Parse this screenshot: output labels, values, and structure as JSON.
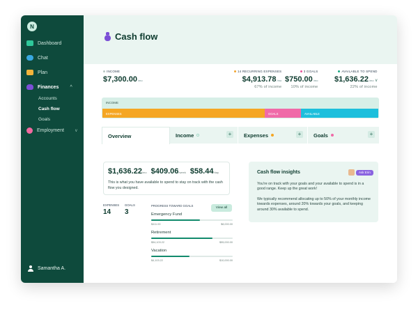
{
  "sidebar": {
    "logo": "N",
    "items": [
      {
        "label": "Dashboard",
        "color": "#2ec89a"
      },
      {
        "label": "Chat",
        "color": "#38a8e0"
      },
      {
        "label": "Plan",
        "color": "#f2b43a"
      },
      {
        "label": "Finances",
        "color": "#7b4fd6"
      },
      {
        "label": "Employment",
        "color": "#f26aa0"
      }
    ],
    "finances_sub": [
      "Accounts",
      "Cash flow",
      "Goals"
    ],
    "user": "Samantha A."
  },
  "header": {
    "title": "Cash flow"
  },
  "summary": {
    "income": {
      "label": "INCOME",
      "amount": "$7,300.00",
      "unit": "/mo"
    },
    "expenses": {
      "label": "14 RECURRING EXPENSES",
      "amount": "$4,913.78",
      "unit": "/mo",
      "pct": "67% of income",
      "color": "#f2a532"
    },
    "goals": {
      "label": "3 GOALS",
      "amount": "$750.00",
      "unit": "/mo",
      "pct": "10% of income",
      "color": "#e8559a"
    },
    "available": {
      "label": "AVAILABLE TO SPEND",
      "amount": "$1,636.22",
      "unit": "/mo",
      "pct": "22% of income",
      "color": "#1aa883"
    }
  },
  "breakdown": {
    "label": "INCOME",
    "segments": [
      {
        "label": "EXPENSES",
        "fraction": 0.588,
        "color": "#f5a623"
      },
      {
        "label": "GOALS",
        "fraction": 0.131,
        "color": "#f06aa8"
      },
      {
        "label": "AVAILABLE",
        "fraction": 0.281,
        "color": "#1cbfdc"
      }
    ]
  },
  "tabs": [
    {
      "label": "Overview",
      "active": true
    },
    {
      "label": "Income",
      "dot": "#9fd6c4"
    },
    {
      "label": "Expenses",
      "dot": "#f5a623"
    },
    {
      "label": "Goals",
      "dot": "#f06aa8"
    }
  ],
  "overview": {
    "daily": "$1,636.22",
    "daily_unit": "/mo",
    "weekly": "$409.06",
    "weekly_unit": "/week",
    "per_day": "$58.44",
    "per_day_unit": "/day",
    "desc": "This is what you have available to spend to stay on track with the cash flow you designed.",
    "expenses_label": "EXPENSES",
    "expenses_count": "14",
    "goals_label": "GOALS",
    "goals_count": "3",
    "progress_title": "PROGRESS TOWARD GOALS",
    "view_all": "View all",
    "goals": [
      {
        "name": "Emergency Fund",
        "current": "$411.00",
        "target": "$8,000.00",
        "progress": 0.6
      },
      {
        "name": "Retirement",
        "current": "$54,103.22",
        "target": "$55,000.00",
        "progress": 0.75
      },
      {
        "name": "Vacation",
        "current": "$4,103.22",
        "target": "$10,000.00",
        "progress": 0.47
      }
    ]
  },
  "insights": {
    "title": "Cash flow insights",
    "ask": "Ask Erin",
    "p1": "You're on track with your goals and your available to spend is in a good range. Keep up the great work!",
    "p2": "We typically recommend allocating up to 50% of your monthly income towards expenses, around 20% towards your goals, and keeping around 30% available to spend."
  }
}
